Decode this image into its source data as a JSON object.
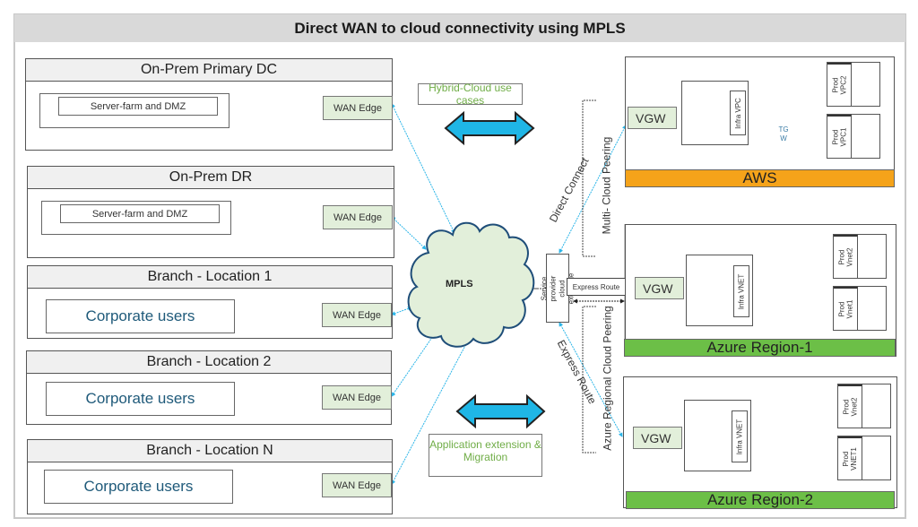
{
  "title": "Direct WAN to cloud connectivity using MPLS",
  "sites": [
    {
      "name": "On-Prem Primary DC",
      "inner": "Server-farm and DMZ",
      "type": "dc",
      "edge": "WAN Edge"
    },
    {
      "name": "On-Prem DR",
      "inner": "Server-farm and DMZ",
      "type": "dc",
      "edge": "WAN Edge"
    },
    {
      "name": "Branch - Location  1",
      "inner": "Corporate users",
      "type": "branch",
      "edge": "WAN Edge"
    },
    {
      "name": "Branch - Location 2",
      "inner": "Corporate users",
      "type": "branch",
      "edge": "WAN Edge"
    },
    {
      "name": "Branch - Location  N",
      "inner": "Corporate users",
      "type": "branch",
      "edge": "WAN Edge"
    }
  ],
  "center": {
    "mpls": "MPLS",
    "hybrid_note": "Hybrid-Cloud use cases",
    "app_note": "Application extension & Migration",
    "sp_exchange": "Service provider cloud exchange",
    "express_route_box": "Express Route",
    "direct_connect": "Direct Connect",
    "multi_cloud_peering": "Multi- Cloud Peering",
    "express_route_diag": "Express Route",
    "azure_regional_peering": "Azure Regional Cloud Peering"
  },
  "clouds": {
    "aws": {
      "banner": "AWS",
      "banner_color": "#f5a31a",
      "vgw": "VGW",
      "infra": "Infra VPC",
      "tgw": "TG\nW",
      "prod2": "Prod\nVPC2",
      "prod1": "Prod\nVPC1"
    },
    "azure1": {
      "banner": "Azure Region-1",
      "banner_color": "#6cbf47",
      "vgw": "VGW",
      "infra": "Infra VNET",
      "prod2": "Prod\nVnet2",
      "prod1": "Prod\nVnet1"
    },
    "azure2": {
      "banner": "Azure  Region-2",
      "banner_color": "#6cbf47",
      "vgw": "VGW",
      "infra": "Infra VNET",
      "prod2": "Prod\nVnet2",
      "prod1": "Prod\nVNET1"
    }
  },
  "colors": {
    "link": "#2bb5e8",
    "arrow_fill": "#1fb6e6",
    "cloud_fill": "#e2efda",
    "cloud_stroke": "#1f4e79"
  }
}
